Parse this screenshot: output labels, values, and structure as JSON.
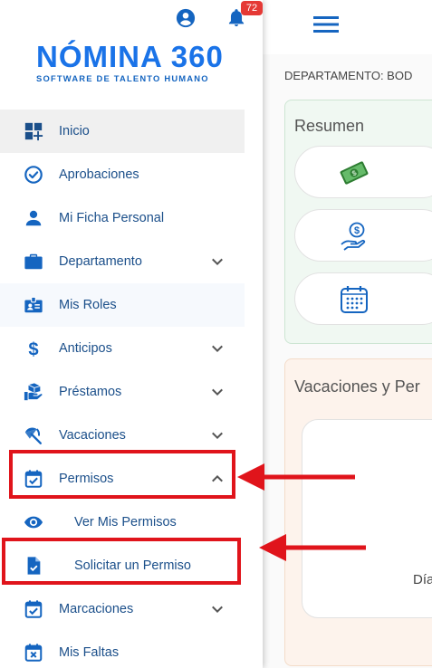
{
  "notifications": {
    "count": "72"
  },
  "logo": {
    "main": "NÓMINA 360",
    "sub": "SOFTWARE DE TALENTO HUMANO"
  },
  "menu": [
    {
      "label": "Inicio",
      "icon": "dashboard-icon"
    },
    {
      "label": "Aprobaciones",
      "icon": "check-circle-icon"
    },
    {
      "label": "Mi Ficha Personal",
      "icon": "person-icon"
    },
    {
      "label": "Departamento",
      "icon": "briefcase-icon"
    },
    {
      "label": "Mis Roles",
      "icon": "badge-icon"
    },
    {
      "label": "Anticipos",
      "icon": "dollar-icon"
    },
    {
      "label": "Préstamos",
      "icon": "loan-icon"
    },
    {
      "label": "Vacaciones",
      "icon": "beach-umbrella-icon"
    },
    {
      "label": "Permisos",
      "icon": "calendar-check-icon"
    },
    {
      "label": "Ver Mis Permisos",
      "icon": "eye-icon"
    },
    {
      "label": "Solicitar un Permiso",
      "icon": "document-check-icon"
    },
    {
      "label": "Marcaciones",
      "icon": "calendar-check-icon"
    },
    {
      "label": "Mis Faltas",
      "icon": "calendar-x-icon"
    }
  ],
  "main": {
    "department_label": "DEPARTAMENTO: BOD",
    "resumen_title": "Resumen",
    "vacaciones_title": "Vacaciones y Per",
    "dias_text": "Día"
  },
  "colors": {
    "brand": "#1a73e8",
    "menu_text": "#1b4f8a",
    "highlight": "#e0141b",
    "badge": "#e53935"
  }
}
